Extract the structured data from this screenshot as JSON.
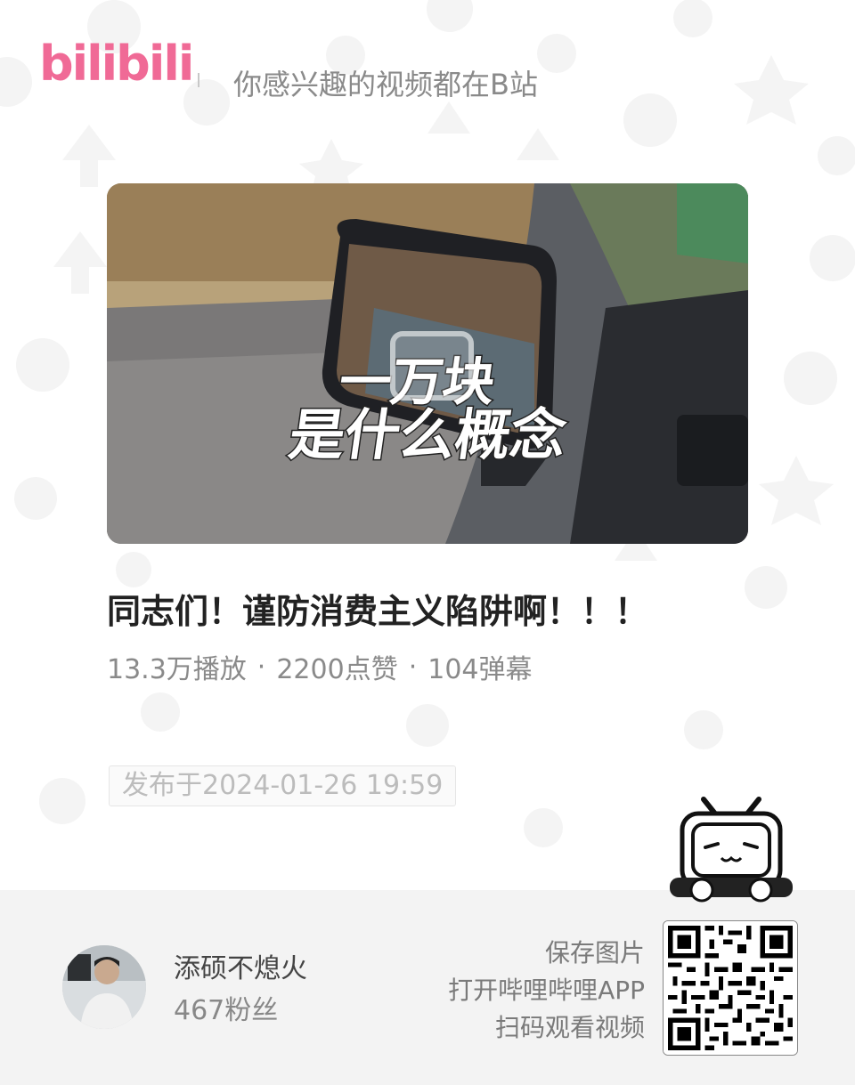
{
  "header": {
    "logo_text": "bilibili",
    "slogan": "你感兴趣的视频都在B站"
  },
  "video": {
    "cover_text_line1": "一万块",
    "cover_text_line2": "是什么概念",
    "title": "同志们！谨防消费主义陷阱啊！！！",
    "views": "13.3万播放",
    "likes": "2200点赞",
    "danmaku": "104弹幕",
    "separator": "·",
    "publish_time": "发布于2024-01-26 19:59"
  },
  "uploader": {
    "name": "添硕不熄火",
    "fans": "467粉丝"
  },
  "qr_hint": {
    "line1": "保存图片",
    "line2": "打开哔哩哔哩APP",
    "line3": "扫码观看视频"
  },
  "icons": [
    "bilibili-logo",
    "tv-watermark-icon",
    "mascot-tv-icon",
    "qr-code",
    "avatar"
  ],
  "colors": {
    "brand_pink": "#f06a96",
    "title_text": "#222222",
    "meta_text": "#8a8a8a",
    "footer_bg": "#f3f3f3"
  }
}
